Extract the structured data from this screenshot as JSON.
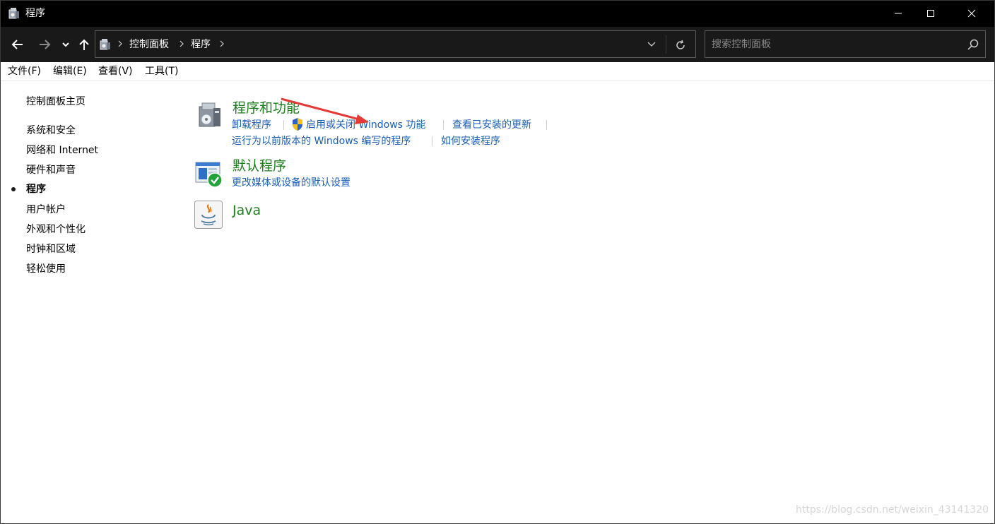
{
  "window": {
    "title": "程序",
    "controls": [
      "minimize-icon",
      "maximize-icon",
      "close-icon"
    ]
  },
  "navigation": {
    "back_icon": "arrow-left-icon",
    "forward_icon": "arrow-right-icon",
    "recent_icon": "chevron-down-icon",
    "up_icon": "arrow-up-icon"
  },
  "address_bar": {
    "breadcrumbs": [
      {
        "label": "控制面板"
      },
      {
        "label": "程序"
      }
    ],
    "dropdown_icon": "chevron-down-icon",
    "refresh_icon": "refresh-icon"
  },
  "search": {
    "placeholder": "搜索控制面板",
    "value": "",
    "icon": "search-icon"
  },
  "menu": {
    "items": [
      {
        "label": "文件(F)"
      },
      {
        "label": "编辑(E)"
      },
      {
        "label": "查看(V)"
      },
      {
        "label": "工具(T)"
      }
    ]
  },
  "sidebar": {
    "home_label": "控制面板主页",
    "items": [
      {
        "label": "系统和安全"
      },
      {
        "label": "网络和 Internet"
      },
      {
        "label": "硬件和声音"
      },
      {
        "label": "程序",
        "current": true
      },
      {
        "label": "用户帐户"
      },
      {
        "label": "外观和个性化"
      },
      {
        "label": "时钟和区域"
      },
      {
        "label": "轻松使用"
      }
    ]
  },
  "categories": [
    {
      "title": "程序和功能",
      "icon": "programs-features-icon",
      "tasks": [
        {
          "label": "卸载程序"
        },
        {
          "label": "启用或关闭 Windows 功能",
          "icon": "uac-shield-icon"
        },
        {
          "label": "查看已安装的更新"
        },
        {
          "label": "运行为以前版本的 Windows 编写的程序"
        },
        {
          "label": "如何安装程序"
        }
      ]
    },
    {
      "title": "默认程序",
      "icon": "default-programs-icon",
      "tasks": [
        {
          "label": "更改媒体或设备的默认设置"
        }
      ]
    },
    {
      "title": "Java",
      "icon": "java-icon",
      "tasks": []
    }
  ],
  "annotation": {
    "icon": "red-arrow-icon",
    "color": "#e53935"
  },
  "watermark": "https://blog.csdn.net/weixin_43141320",
  "colors": {
    "titlebar_bg": "#000000",
    "navbar_bg": "#191919",
    "link": "#1a5fb4",
    "category_title": "#1e7d1e"
  }
}
